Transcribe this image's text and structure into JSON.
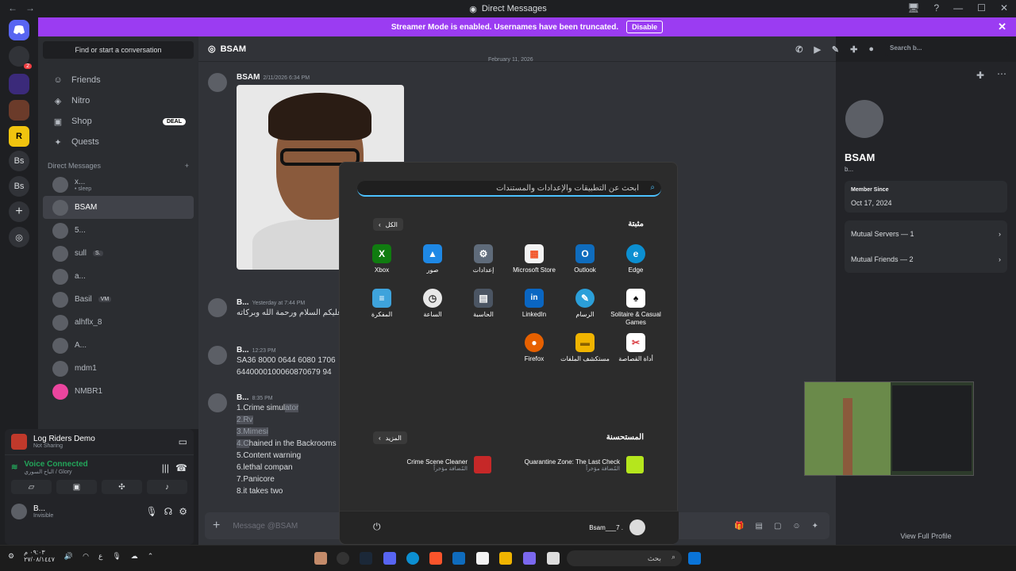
{
  "titlebar": {
    "title": "Direct Messages",
    "back": "←",
    "forward": "→",
    "win_buttons": [
      "🖥",
      "?",
      "—",
      "☐",
      "✕"
    ]
  },
  "banner": {
    "text": "Streamer Mode is enabled. Usernames have been truncated.",
    "button": "Disable",
    "close": "✕"
  },
  "servers": [
    {
      "label": "Bs"
    },
    {
      "label": "Bs"
    }
  ],
  "sidebar": {
    "find": "Find or start a conversation",
    "nav": [
      {
        "label": "Friends",
        "icon": "friends-icon"
      },
      {
        "label": "Nitro",
        "icon": "nitro-icon"
      },
      {
        "label": "Shop",
        "icon": "shop-icon",
        "badge": "DEAL"
      },
      {
        "label": "Quests",
        "icon": "quests-icon"
      }
    ],
    "dm_header": "Direct Messages",
    "dm_add": "+",
    "dms": [
      {
        "name": "x...",
        "sub": "• sleep"
      },
      {
        "name": "BSAM"
      },
      {
        "name": "5..."
      },
      {
        "name": "sull",
        "tag": "S."
      },
      {
        "name": "a..."
      },
      {
        "name": "Basil",
        "tag": "VM"
      },
      {
        "name": "alhflx_8"
      },
      {
        "name": "A..."
      },
      {
        "name": "mdm1"
      },
      {
        "name": "NMBR1"
      }
    ]
  },
  "userpanel": {
    "activity_title": "Log Riders Demo",
    "activity_sub": "Not Sharing",
    "voice": "Voice Connected",
    "voice_sub": "الباح السوري / Glory",
    "user": "B...",
    "status": "Invisible"
  },
  "chat": {
    "header": "BSAM",
    "search": "Search b...",
    "date_divider": "February 11, 2026",
    "messages": [
      {
        "author": "BSAM",
        "time": "2/11/2026 6:34 PM"
      },
      {
        "author": "B...",
        "time": "Yesterday at 7:44 PM",
        "text": "وعليكم السلام ورحمة الله وبركاته"
      },
      {
        "author": "B...",
        "time": "12:23 PM",
        "lines": [
          "SA36 8000 0644 6080 1706",
          "6440000100060870679 94"
        ]
      },
      {
        "author": "B...",
        "time": "8:35 PM",
        "lines": [
          "1.Crime simul",
          "ator",
          "2.Rv",
          "3.Mimesi",
          "4.C",
          "hained in the Backrooms",
          "5.Content warning",
          "6.lethal compan",
          "7.Panicore",
          "8.it takes two"
        ]
      }
    ],
    "composer": "Message @BSAM"
  },
  "profile": {
    "name": "BSAM",
    "handle": "b...",
    "member_since_label": "Member Since",
    "member_since": "Oct 17, 2024",
    "mutual_servers": "Mutual Servers — 1",
    "mutual_friends": "Mutual Friends — 2",
    "view_full": "View Full Profile"
  },
  "start": {
    "search": "ابحث عن التطبيقات والإعدادات والمستندات",
    "pinned": "مثبتة",
    "all": "الكل",
    "apps": [
      {
        "name": "Xbox",
        "color": "#107c10",
        "glyph": "X"
      },
      {
        "name": "صور",
        "color": "#1e88e5",
        "glyph": "▲"
      },
      {
        "name": "إعدادات",
        "color": "#5f6b7a",
        "glyph": "⚙"
      },
      {
        "name": "Microsoft Store",
        "color": "#f3f3f3",
        "glyph": "▦"
      },
      {
        "name": "Outlook",
        "color": "#0f6cbd",
        "glyph": "O"
      },
      {
        "name": "Edge",
        "color": "#0c8fd1",
        "glyph": "e"
      },
      {
        "name": "المفكرة",
        "color": "#3ea3dc",
        "glyph": "≡"
      },
      {
        "name": "الساعة",
        "color": "#e8e8e8",
        "glyph": "◷"
      },
      {
        "name": "الحاسبة",
        "color": "#4b5563",
        "glyph": "▤"
      },
      {
        "name": "LinkedIn",
        "color": "#0a66c2",
        "glyph": "in"
      },
      {
        "name": "الرسام",
        "color": "#2b9fd9",
        "glyph": "✎"
      },
      {
        "name": "Solitaire & Casual Games",
        "color": "#1a1a1a",
        "glyph": "♠"
      },
      {
        "name": "Firefox",
        "color": "#e66000",
        "glyph": "●"
      },
      {
        "name": "مستكشف الملفات",
        "color": "#f0b400",
        "glyph": "▬"
      },
      {
        "name": "أداة القصاصة",
        "color": "#d9393f",
        "glyph": "✂"
      }
    ],
    "recommended": "المستحسنة",
    "more": "المزيد",
    "recs": [
      {
        "name": "Quarantine Zone: The Last Check",
        "sub": "المُضافة مؤخراً",
        "color": "#b5e61d"
      },
      {
        "name": "Crime Scene Cleaner",
        "sub": "المُضافة مؤخراً",
        "color": "#c62828"
      }
    ],
    "user": "Bsam___7 ."
  },
  "taskbar": {
    "search": "بحث",
    "time": "٠٩:٠٣ م",
    "date": "٢٧/٠٨/١٤٤٧",
    "lang": "ع"
  }
}
